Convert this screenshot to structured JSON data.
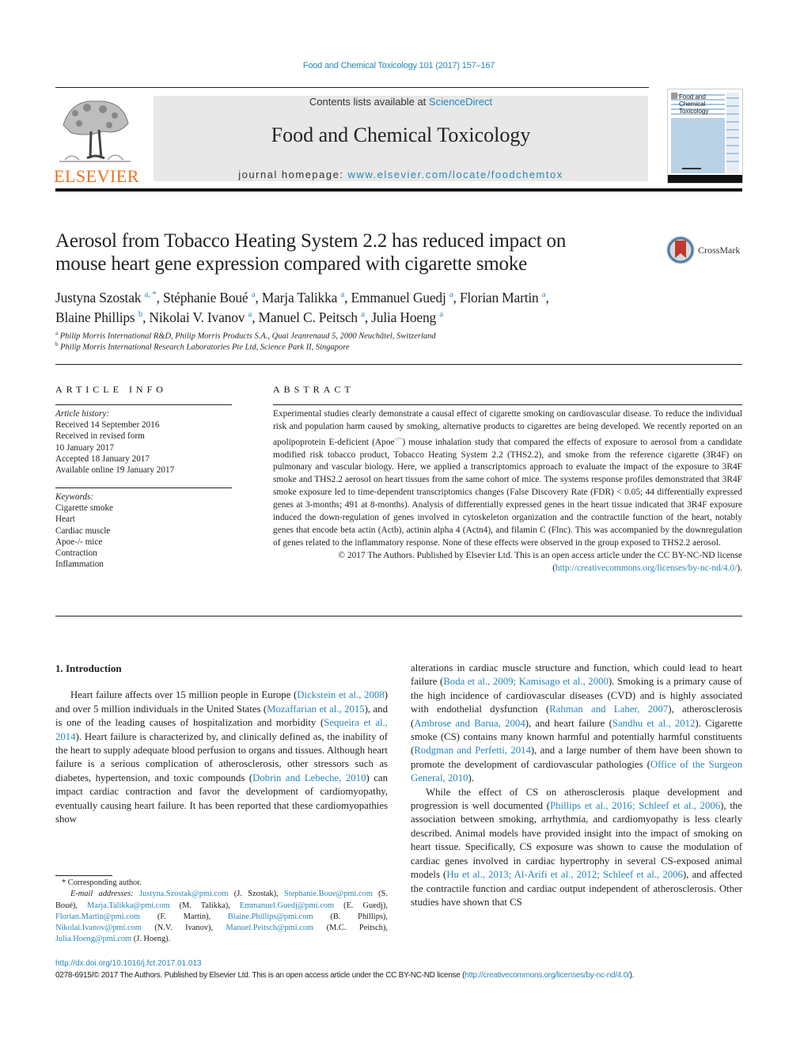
{
  "header": {
    "journal_ref": "Food and Chemical Toxicology 101 (2017) 157–167",
    "contents_prefix": "Contents lists available at ",
    "contents_link": "ScienceDirect",
    "journal_title": "Food and Chemical Toxicology",
    "homepage_prefix": "journal homepage: ",
    "homepage_link": "www.elsevier.com/locate/foodchemtox",
    "publisher_logo": "ELSEVIER",
    "cover": {
      "title_lines": [
        "Food and",
        "Chemical",
        "Toxicology"
      ],
      "colors": {
        "stripe": "#a9c6dd",
        "panel": "#b9d2e6",
        "bar": "#111111"
      }
    }
  },
  "article": {
    "title_line1": "Aerosol from Tobacco Heating System 2.2 has reduced impact on",
    "title_line2": "mouse heart gene expression compared with cigarette smoke",
    "crossmark_label": "CrossMark",
    "authors": [
      {
        "name": "Justyna Szostak",
        "sup": "a, *"
      },
      {
        "name": "Stéphanie Boué",
        "sup": "a"
      },
      {
        "name": "Marja Talikka",
        "sup": "a"
      },
      {
        "name": "Emmanuel Guedj",
        "sup": "a"
      },
      {
        "name": "Florian Martin",
        "sup": "a"
      },
      {
        "name": "Blaine Phillips",
        "sup": "b"
      },
      {
        "name": "Nikolai V. Ivanov",
        "sup": "a"
      },
      {
        "name": "Manuel C. Peitsch",
        "sup": "a"
      },
      {
        "name": "Julia Hoeng",
        "sup": "a"
      }
    ],
    "affiliations": [
      {
        "mark": "a",
        "text": "Philip Morris International R&D, Philip Morris Products S.A., Quai Jeanrenaud 5, 2000 Neuchâtel, Switzerland"
      },
      {
        "mark": "b",
        "text": "Philip Morris International Research Laboratories Pte Ltd, Science Park II, Singapore"
      }
    ]
  },
  "article_info": {
    "heading": "ARTICLE INFO",
    "history_label": "Article history:",
    "history": [
      "Received 14 September 2016",
      "Received in revised form",
      "10 January 2017",
      "Accepted 18 January 2017",
      "Available online 19 January 2017"
    ],
    "keywords_label": "Keywords:",
    "keywords": [
      "Cigarette smoke",
      "Heart",
      "Cardiac muscle",
      "Apoe-/- mice",
      "Contraction",
      "Inflammation"
    ]
  },
  "abstract": {
    "heading": "ABSTRACT",
    "text_part1": "Experimental studies clearly demonstrate a causal effect of cigarette smoking on cardiovascular disease. To reduce the individual risk and population harm caused by smoking, alternative products to cigarettes are being developed. We recently reported on an apolipoprotein E-deficient (Apoe",
    "text_sup": "−/−",
    "text_part2": ") mouse inhalation study that compared the effects of exposure to aerosol from a candidate modified risk tobacco product, Tobacco Heating System 2.2 (THS2.2), and smoke from the reference cigarette (3R4F) on pulmonary and vascular biology. Here, we applied a transcriptomics approach to evaluate the impact of the exposure to 3R4F smoke and THS2.2 aerosol on heart tissues from the same cohort of mice. The systems response profiles demonstrated that 3R4F smoke exposure led to time-dependent transcriptomics changes (False Discovery Rate (FDR) < 0.05; 44 differentially expressed genes at 3-months; 491 at 8-months). Analysis of differentially expressed genes in the heart tissue indicated that 3R4F exposure induced the down-regulation of genes involved in cytoskeleton organization and the contractile function of the heart, notably genes that encode beta actin (Actb), actinin alpha 4 (Actn4), and filamin C (Flnc). This was accompanied by the downregulation of genes related to the inflammatory response. None of these effects were observed in the group exposed to THS2.2 aerosol.",
    "copyright_prefix": "© 2017 The Authors. Published by Elsevier Ltd. This is an open access article under the CC BY-NC-ND license (",
    "copyright_link": "http://creativecommons.org/licenses/by-nc-nd/4.0/",
    "copyright_suffix": ")."
  },
  "intro": {
    "heading": "1.  Introduction",
    "left": [
      {
        "t": "Heart failure affects over 15 million people in Europe ("
      },
      {
        "l": "Dickstein et al., 2008"
      },
      {
        "t": ") and over 5 million individuals in the United States ("
      },
      {
        "l": "Mozaffarian et al., 2015"
      },
      {
        "t": "), and is one of the leading causes of hospitalization and morbidity ("
      },
      {
        "l": "Sequeira et al., 2014"
      },
      {
        "t": "). Heart failure is characterized by, and clinically defined as, the inability of the heart to supply adequate blood perfusion to organs and tissues. Although heart failure is a serious complication of atherosclerosis, other stressors such as diabetes, hypertension, and toxic compounds ("
      },
      {
        "l": "Dobrin and Lebeche, 2010"
      },
      {
        "t": ") can impact cardiac contraction and favor the development of cardiomyopathy, eventually causing heart failure. It has been reported that these cardiomyopathies show"
      }
    ],
    "right_p1": [
      {
        "t": "alterations in cardiac muscle structure and function, which could lead to heart failure ("
      },
      {
        "l": "Boda et al., 2009; Kamisago et al., 2000"
      },
      {
        "t": "). Smoking is a primary cause of the high incidence of cardiovascular diseases (CVD) and is highly associated with endothelial dysfunction ("
      },
      {
        "l": "Rahman and Laher, 2007"
      },
      {
        "t": "), atherosclerosis ("
      },
      {
        "l": "Ambrose and Barua, 2004"
      },
      {
        "t": "), and heart failure ("
      },
      {
        "l": "Sandhu et al., 2012"
      },
      {
        "t": "). Cigarette smoke (CS) contains many known harmful and potentially harmful constituents ("
      },
      {
        "l": "Rodgman and Perfetti, 2014"
      },
      {
        "t": "), and a large number of them have been shown to promote the development of cardiovascular pathologies ("
      },
      {
        "l": "Office of the Surgeon General, 2010"
      },
      {
        "t": ")."
      }
    ],
    "right_p2": [
      {
        "t": "While the effect of CS on atherosclerosis plaque development and progression is well documented ("
      },
      {
        "l": "Phillips et al., 2016; Schleef et al., 2006"
      },
      {
        "t": "), the association between smoking, arrhythmia, and cardiomyopathy is less clearly described. Animal models have provided insight into the impact of smoking on heart tissue. Specifically, CS exposure was shown to cause the modulation of cardiac genes involved in cardiac hypertrophy in several CS-exposed animal models ("
      },
      {
        "l": "Hu et al., 2013; Al-Arifi et al., 2012; Schleef et al., 2006"
      },
      {
        "t": "), and affected the contractile function and cardiac output independent of atherosclerosis. Other studies have shown that CS"
      }
    ]
  },
  "footnotes": {
    "corresponding": "* Corresponding author.",
    "email_label": "E-mail addresses: ",
    "emails": [
      {
        "email": "Justyna.Szostak@pmi.com",
        "who": " (J. Szostak), "
      },
      {
        "email": "Stephanie.Boue@pmi.com",
        "who": " (S. Boué), "
      },
      {
        "email": "Marja.Talikka@pmi.com",
        "who": " (M. Talikka), "
      },
      {
        "email": "Emmanuel.Guedj@pmi.com",
        "who": " (E. Guedj), "
      },
      {
        "email": "Florian.Martin@pmi.com",
        "who": " (F. Martin), "
      },
      {
        "email": "Blaine.Phillips@pmi.com",
        "who": " (B. Phillips), "
      },
      {
        "email": "Nikolai.Ivanov@pmi.com",
        "who": " (N.V. Ivanov), "
      },
      {
        "email": "Manuel.Peitsch@pmi.com",
        "who": " (M.C. Peitsch), "
      },
      {
        "email": "Julia.Hoeng@pmi.com",
        "who": " (J. Hoeng)."
      }
    ]
  },
  "footer": {
    "doi": "http://dx.doi.org/10.1016/j.fct.2017.01.013",
    "license_prefix": "0278-6915/© 2017 The Authors. Published by Elsevier Ltd. This is an open access article under the CC BY-NC-ND license (",
    "license_link": "http://creativecommons.org/licenses/by-nc-nd/4.0/",
    "license_suffix": ")."
  }
}
